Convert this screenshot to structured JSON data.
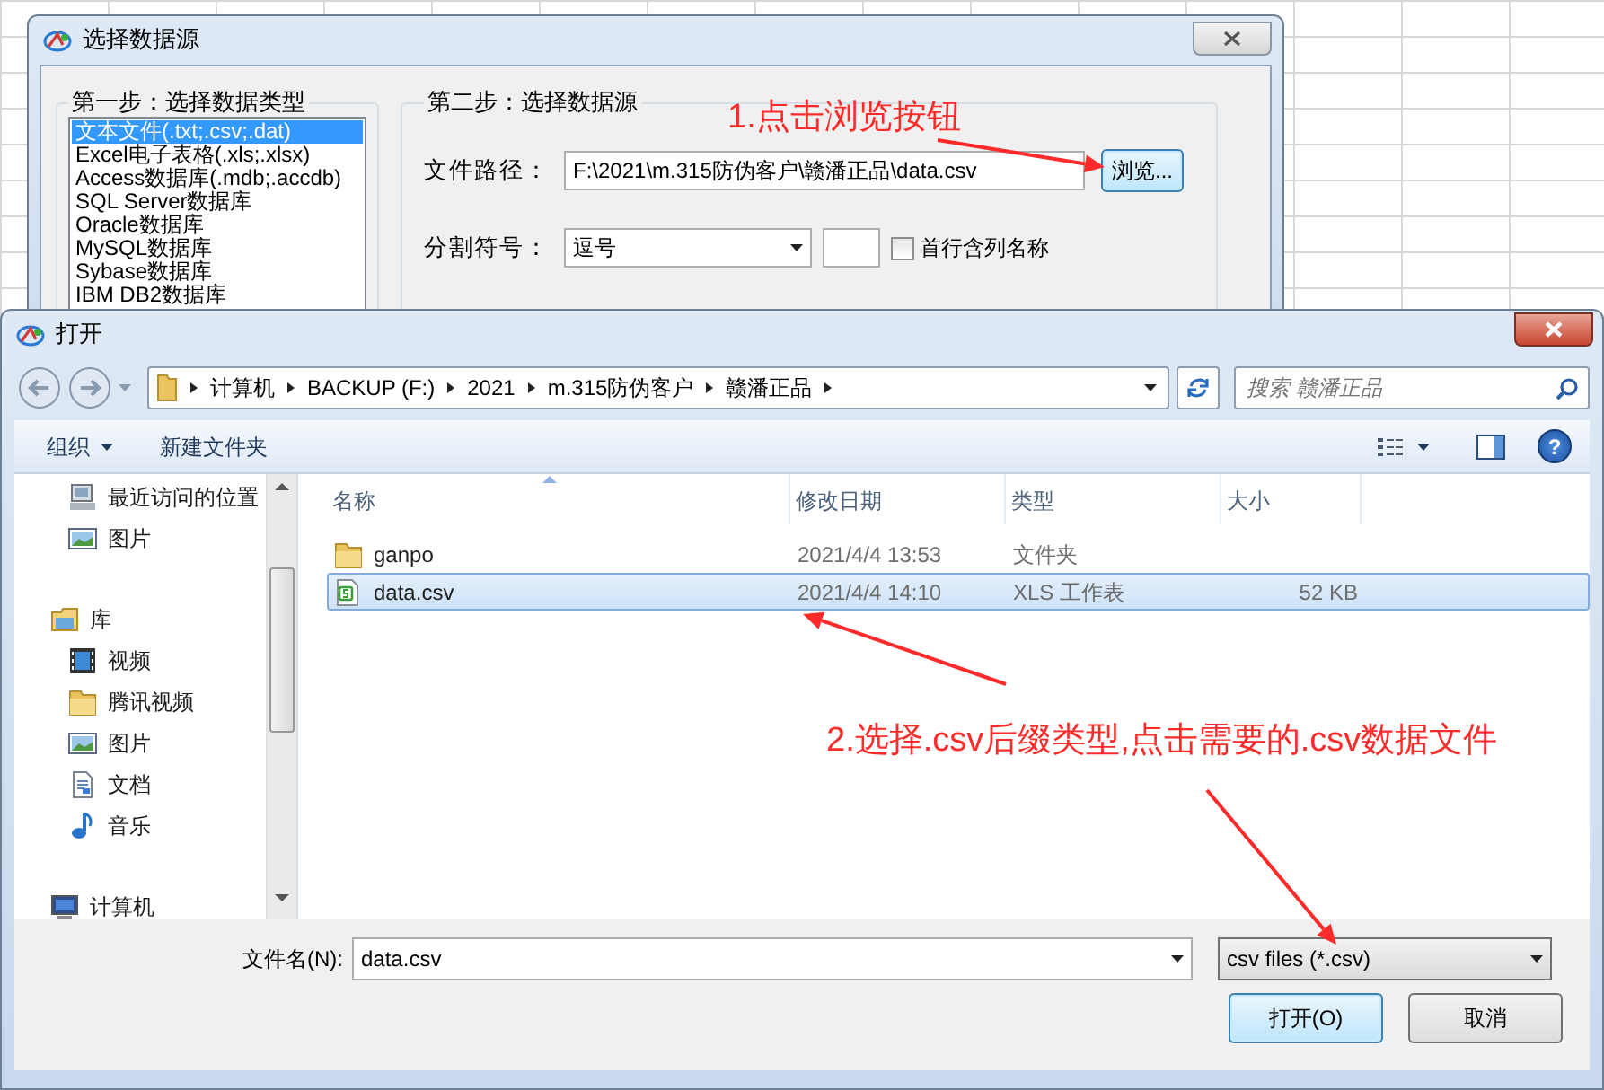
{
  "back_window": {
    "title": "选择数据源",
    "step1": {
      "title": "第一步：选择数据类型",
      "items": [
        {
          "label": "文本文件(.txt;.csv;.dat)",
          "selected": true
        },
        {
          "label": "Excel电子表格(.xls;.xlsx)",
          "selected": false
        },
        {
          "label": "Access数据库(.mdb;.accdb)",
          "selected": false
        },
        {
          "label": "SQL Server数据库",
          "selected": false
        },
        {
          "label": "Oracle数据库",
          "selected": false
        },
        {
          "label": "MySQL数据库",
          "selected": false
        },
        {
          "label": "Sybase数据库",
          "selected": false
        },
        {
          "label": "IBM DB2数据库",
          "selected": false
        }
      ]
    },
    "step2": {
      "title": "第二步：选择数据源",
      "path_label": "文件路径：",
      "path_value": "F:\\2021\\m.315防伪客户\\赣潘正品\\data.csv",
      "browse_button": "浏览...",
      "separator_label": "分割符号：",
      "separator_value": "逗号",
      "header_checkbox": {
        "label": "首行含列名称",
        "checked": false
      }
    }
  },
  "open_dialog": {
    "title": "打开",
    "breadcrumb": [
      "计算机",
      "BACKUP (F:)",
      "2021",
      "m.315防伪客户",
      "赣潘正品"
    ],
    "search": {
      "placeholder": "搜索 赣潘正品"
    },
    "toolbar": [
      {
        "label": "组织",
        "kind": "menu"
      },
      {
        "label": "新建文件夹",
        "kind": "button"
      }
    ],
    "help_button": "?",
    "navigation": [
      {
        "children": [
          {
            "label": "最近访问的位置",
            "kind": "recent"
          },
          {
            "label": "图片",
            "kind": "pictures"
          }
        ]
      },
      {
        "label": "库",
        "kind": "library",
        "children": [
          {
            "label": "视频",
            "kind": "video"
          },
          {
            "label": "腾讯视频",
            "kind": "folder"
          },
          {
            "label": "图片",
            "kind": "pictures"
          },
          {
            "label": "文档",
            "kind": "documents"
          },
          {
            "label": "音乐",
            "kind": "music"
          }
        ]
      },
      {
        "label": "计算机",
        "kind": "computer"
      }
    ],
    "columns": [
      {
        "label": "名称",
        "sorted": true
      },
      {
        "label": "修改日期",
        "sorted": false
      },
      {
        "label": "类型",
        "sorted": false
      },
      {
        "label": "大小",
        "sorted": false
      }
    ],
    "files": [
      {
        "name": "ganpo",
        "kind": "folder",
        "modified": "2021/4/4 13:53",
        "type": "文件夹",
        "selected": false
      },
      {
        "name": "data.csv",
        "kind": "csv",
        "modified": "2021/4/4 14:10",
        "type": "XLS 工作表",
        "size": "52 KB",
        "selected": true
      }
    ],
    "file_name": {
      "label": "文件名(N):",
      "value": "data.csv"
    },
    "file_type": "csv files (*.csv)",
    "buttons": [
      {
        "label": "打开(O)",
        "kind": "primary"
      },
      {
        "label": "取消",
        "kind": "normal"
      }
    ]
  },
  "annotations": [
    {
      "text": "1.点击浏览按钮"
    },
    {
      "text": "2.选择.csv后缀类型,点击需要的.csv数据文件"
    }
  ]
}
